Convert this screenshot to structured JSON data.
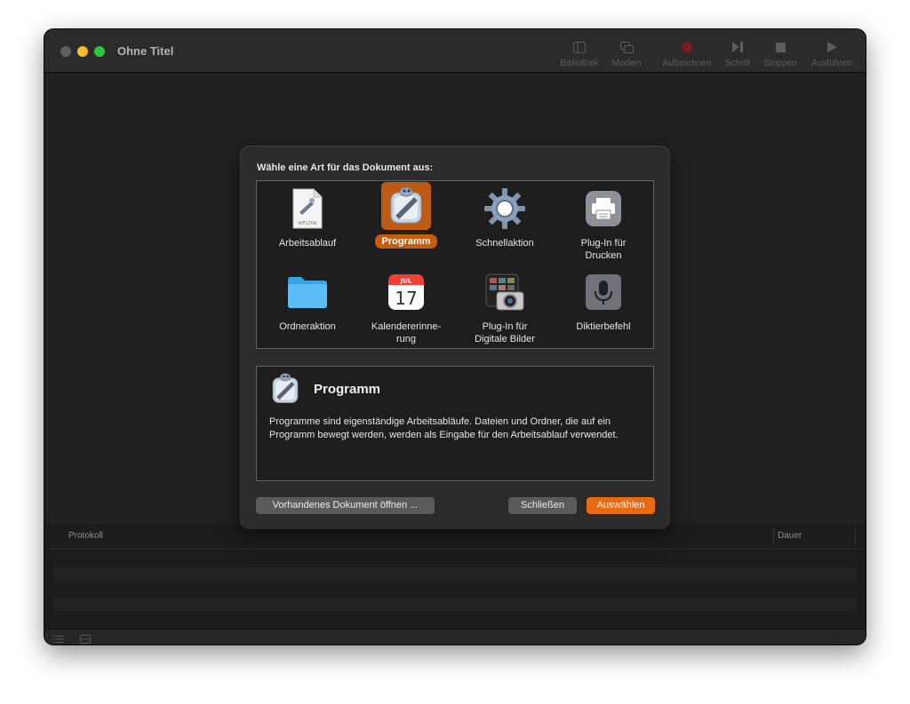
{
  "window": {
    "title": "Ohne Titel"
  },
  "toolbar": {
    "items": [
      {
        "label": "Bibliothek"
      },
      {
        "label": "Medien"
      },
      {
        "label": "Aufzeichnen"
      },
      {
        "label": "Schritt"
      },
      {
        "label": "Stoppen"
      },
      {
        "label": "Ausführen"
      }
    ]
  },
  "dialog": {
    "prompt": "Wähle eine Art für das Dokument aus:",
    "types": [
      {
        "label": "Arbeitsablauf",
        "icon": "workflow-file-icon",
        "badge": "WFLOW"
      },
      {
        "label": "Programm",
        "icon": "automator-robot-icon",
        "selected": true
      },
      {
        "label": "Schnellaktion",
        "icon": "gear-icon"
      },
      {
        "label": "Plug-In für Drucken",
        "icon": "printer-icon"
      },
      {
        "label": "Ordneraktion",
        "icon": "folder-icon"
      },
      {
        "label": "Kalendererinne-rung",
        "icon": "calendar-icon",
        "month": "JUL",
        "day": "17"
      },
      {
        "label": "Plug-In für Digitale Bilder",
        "icon": "image-capture-icon"
      },
      {
        "label": "Diktierbefehl",
        "icon": "microphone-icon"
      }
    ],
    "description": {
      "title": "Programm",
      "text": "Programme sind eigenständige Arbeitsabläufe. Dateien und Ordner, die auf ein Programm bewegt werden, werden als Eingabe für den Arbeitsablauf verwendet."
    },
    "buttons": {
      "open_existing": "Vorhandenes Dokument öffnen ...",
      "close": "Schließen",
      "choose": "Auswählen"
    }
  },
  "log": {
    "col_protocol": "Protokoll",
    "col_duration": "Dauer"
  },
  "colors": {
    "accent": "#e86a12",
    "selection": "#c65c10",
    "close": "#ff5f57",
    "minimize": "#febc2e",
    "zoom": "#28c840"
  }
}
